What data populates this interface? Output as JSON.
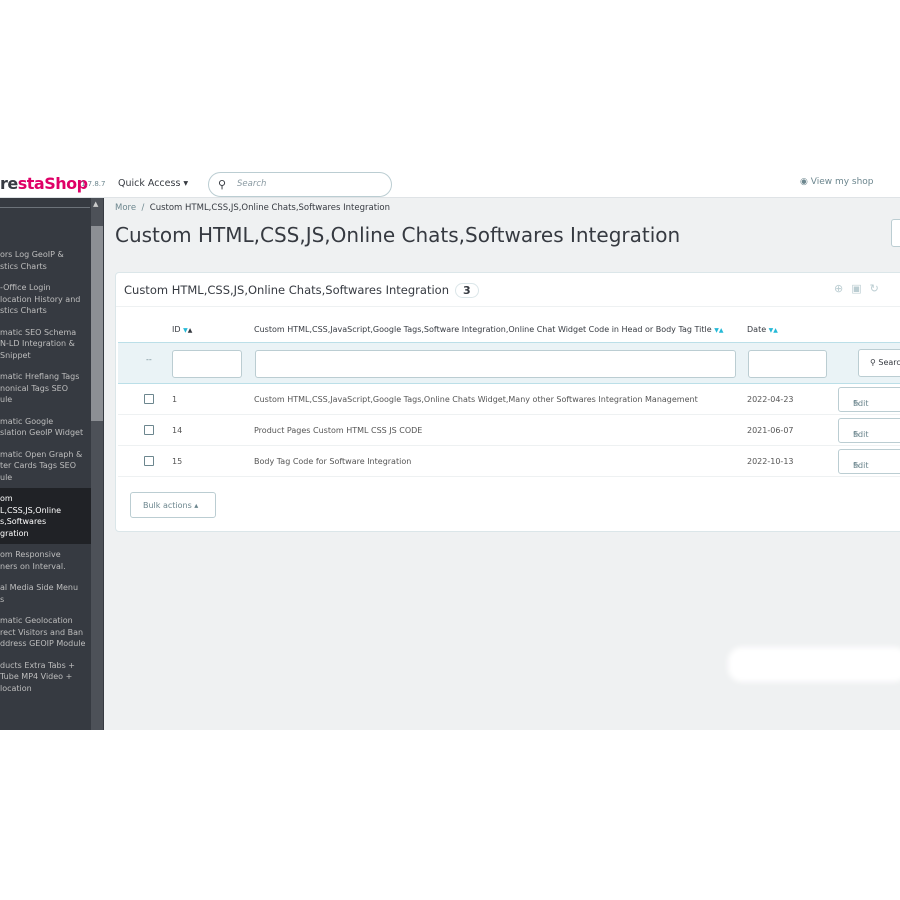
{
  "header": {
    "logo_prefix": "re",
    "logo_brand": "staShop",
    "version": "1.7.8.7",
    "quick_access": "Quick Access ▾",
    "search_placeholder": "Search",
    "view_shop": "View my shop"
  },
  "sidebar": {
    "items": [
      {
        "label": "ors Log GeoIP &\nstics Charts"
      },
      {
        "label": "-Office Login\nlocation History and\nstics Charts"
      },
      {
        "label": "matic SEO Schema\nN-LD Integration &\nSnippet"
      },
      {
        "label": "matic Hreflang Tags\nnonical Tags SEO\nule"
      },
      {
        "label": "matic Google\nslation GeoIP Widget"
      },
      {
        "label": "matic Open Graph &\nter Cards Tags SEO\nule"
      },
      {
        "label": "om\nL,CSS,JS,Online\ns,Softwares\ngration",
        "active": true
      },
      {
        "label": "om Responsive\nners on Interval."
      },
      {
        "label": "al Media Side Menu\ns"
      },
      {
        "label": "matic Geolocation\nrect Visitors and Ban\nddress GEOIP Module"
      },
      {
        "label": "ducts Extra Tabs +\nTube MP4 Video +\nlocation"
      }
    ]
  },
  "breadcrumb": {
    "parent": "More",
    "separator": "/",
    "current": "Custom HTML,CSS,JS,Online Chats,Softwares Integration"
  },
  "page_title": "Custom HTML,CSS,JS,Online Chats,Softwares Integration",
  "panel": {
    "title": "Custom HTML,CSS,JS,Online Chats,Softwares Integration",
    "count": "3",
    "columns": {
      "id": "ID",
      "title": "Custom HTML,CSS,JavaScript,Google Tags,Software Integration,Online Chat Widget Code in Head or Body Tag Title",
      "date": "Date"
    },
    "filter_dash": "--",
    "search_label": "Search",
    "rows": [
      {
        "id": "1",
        "title": "Custom HTML,CSS,JavaScript,Google Tags,Online Chats Widget,Many other Softwares Integration Management",
        "date": "2022-04-23",
        "action": "Edit"
      },
      {
        "id": "14",
        "title": "Product Pages Custom HTML CSS JS CODE",
        "date": "2021-06-07",
        "action": "Edit"
      },
      {
        "id": "15",
        "title": "Body Tag Code for Software Integration",
        "date": "2022-10-13",
        "action": "Edit"
      }
    ],
    "bulk_actions": "Bulk actions ▴"
  },
  "colors": {
    "brand": "#df0067",
    "accent": "#25b9d7",
    "sidebar": "#363a41"
  }
}
